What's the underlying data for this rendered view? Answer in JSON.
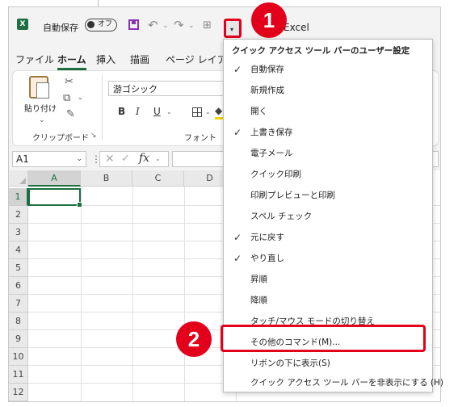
{
  "titlebar": {
    "app_logo": "X",
    "autosave_label": "自動保存",
    "autosave_toggle": "オフ",
    "title_fragment": "Excel",
    "icons": [
      "excel-logo-icon",
      "save-icon",
      "undo-icon",
      "redo-icon",
      "table-icon",
      "customize-qat-icon"
    ]
  },
  "tabs": [
    "ファイル",
    "ホーム",
    "挿入",
    "描画",
    "ページ レイアウト"
  ],
  "ribbon": {
    "paste_label": "貼り付け",
    "clipboard_group": "クリップボード",
    "font_name": "游ゴシック",
    "font_group": "フォント",
    "bold": "B",
    "italic": "I",
    "underline": "U"
  },
  "formula_bar": {
    "name_box": "A1",
    "fx": "fx"
  },
  "sheet": {
    "columns": [
      "A",
      "B",
      "C",
      "D"
    ],
    "rows": [
      "1",
      "2",
      "3",
      "4",
      "5",
      "6",
      "7",
      "8",
      "9",
      "10",
      "11",
      "12"
    ],
    "active_cell": "A1"
  },
  "dropdown": {
    "header": "クイック アクセス ツール バーのユーザー設定",
    "items": [
      {
        "label": "自動保存",
        "checked": true
      },
      {
        "label": "新規作成",
        "checked": false
      },
      {
        "label": "開く",
        "checked": false
      },
      {
        "label": "上書き保存",
        "checked": true
      },
      {
        "label": "電子メール",
        "checked": false
      },
      {
        "label": "クイック印刷",
        "checked": false
      },
      {
        "label": "印刷プレビューと印刷",
        "checked": false
      },
      {
        "label": "スペル チェック",
        "checked": false
      },
      {
        "label": "元に戻す",
        "checked": true
      },
      {
        "label": "やり直し",
        "checked": true
      },
      {
        "label": "昇順",
        "checked": false
      },
      {
        "label": "降順",
        "checked": false
      },
      {
        "label": "タッチ/マウス モードの切り替え",
        "checked": false
      },
      {
        "label": "その他のコマンド(M)...",
        "checked": false
      },
      {
        "label": "リボンの下に表示(S)",
        "checked": false
      },
      {
        "label": "クイック アクセス ツール バーを非表示にする (H)",
        "checked": false
      }
    ]
  },
  "annotations": {
    "step1": "1",
    "step2": "2",
    "accent_color": "#e3001b"
  }
}
